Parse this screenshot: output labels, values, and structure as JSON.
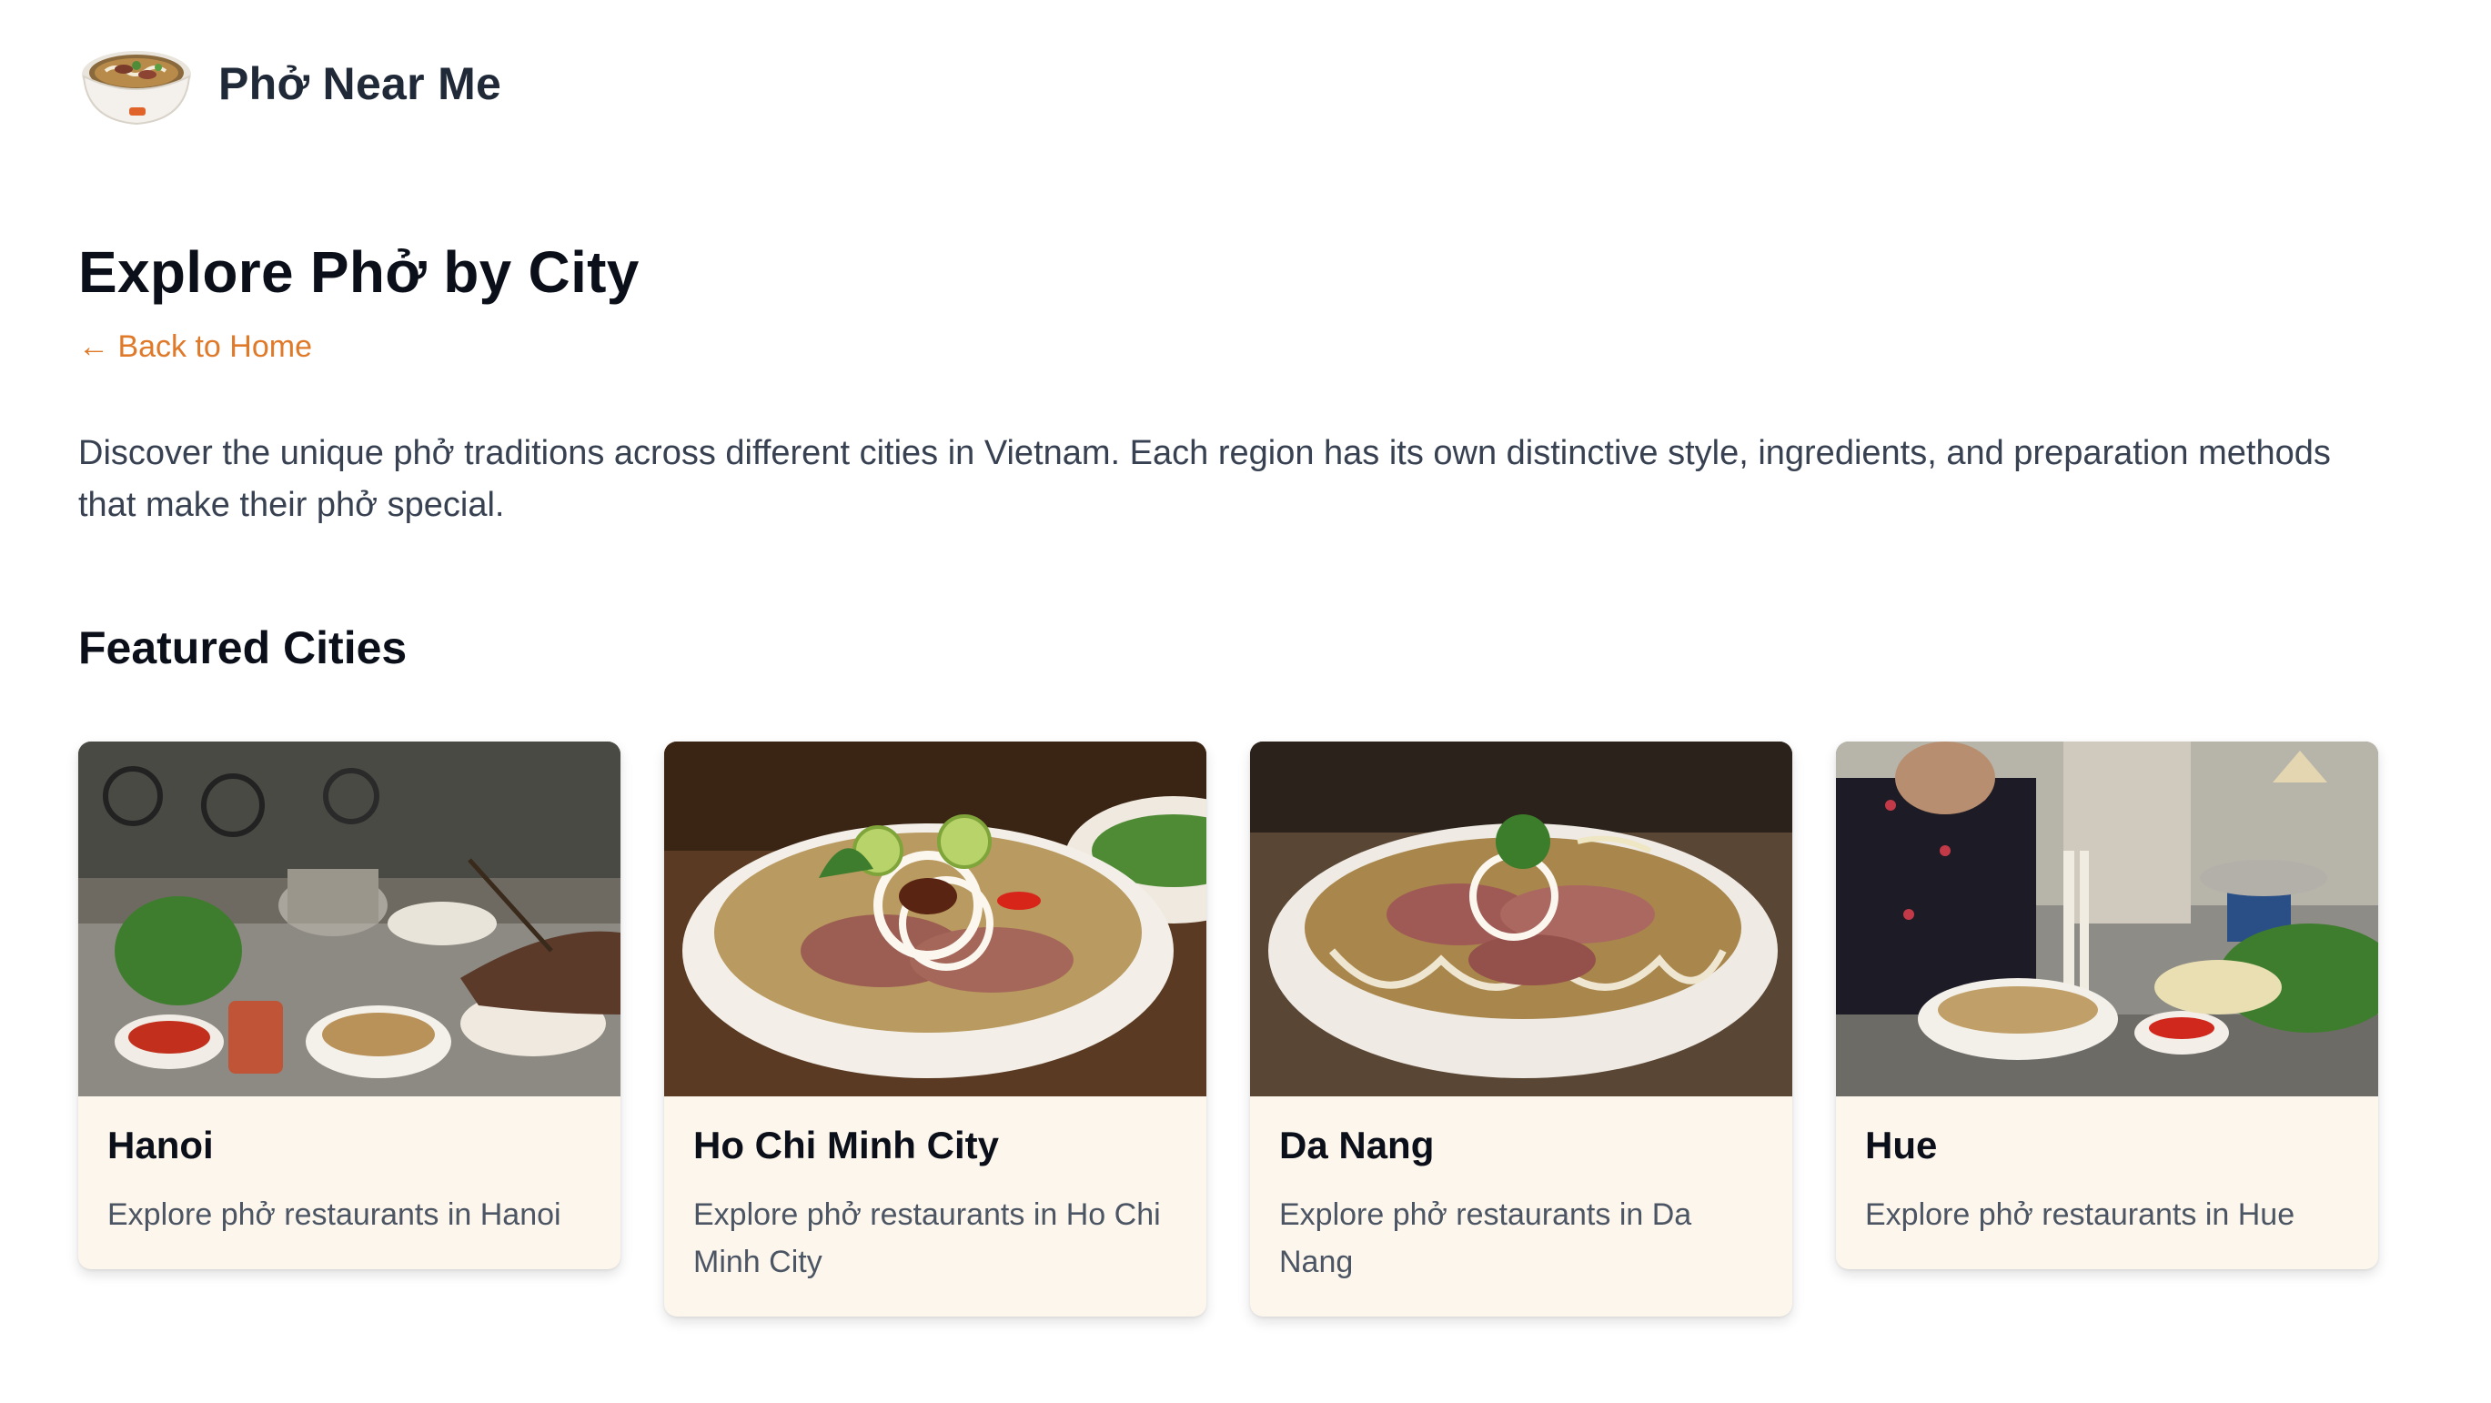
{
  "header": {
    "site_name": "Phở Near Me"
  },
  "page": {
    "title": "Explore Phở by City",
    "back_link": "← Back to Home",
    "intro": "Discover the unique phở traditions across different cities in Vietnam. Each region has its own distinctive style, ingredients, and preparation methods that make their phở special.",
    "section_title": "Featured Cities"
  },
  "cities": [
    {
      "name": "Hanoi",
      "description": "Explore phở restaurants in Hanoi"
    },
    {
      "name": "Ho Chi Minh City",
      "description": "Explore phở restaurants in Ho Chi Minh City"
    },
    {
      "name": "Da Nang",
      "description": "Explore phở restaurants in Da Nang"
    },
    {
      "name": "Hue",
      "description": "Explore phở restaurants in Hue"
    }
  ],
  "colors": {
    "accent": "#e07a2b",
    "card_background": "#fdf6ec",
    "heading": "#0b0f19",
    "body_text": "#374151"
  },
  "icons": {
    "logo": "pho-bowl-logo-icon",
    "back": "arrow-left-icon"
  }
}
